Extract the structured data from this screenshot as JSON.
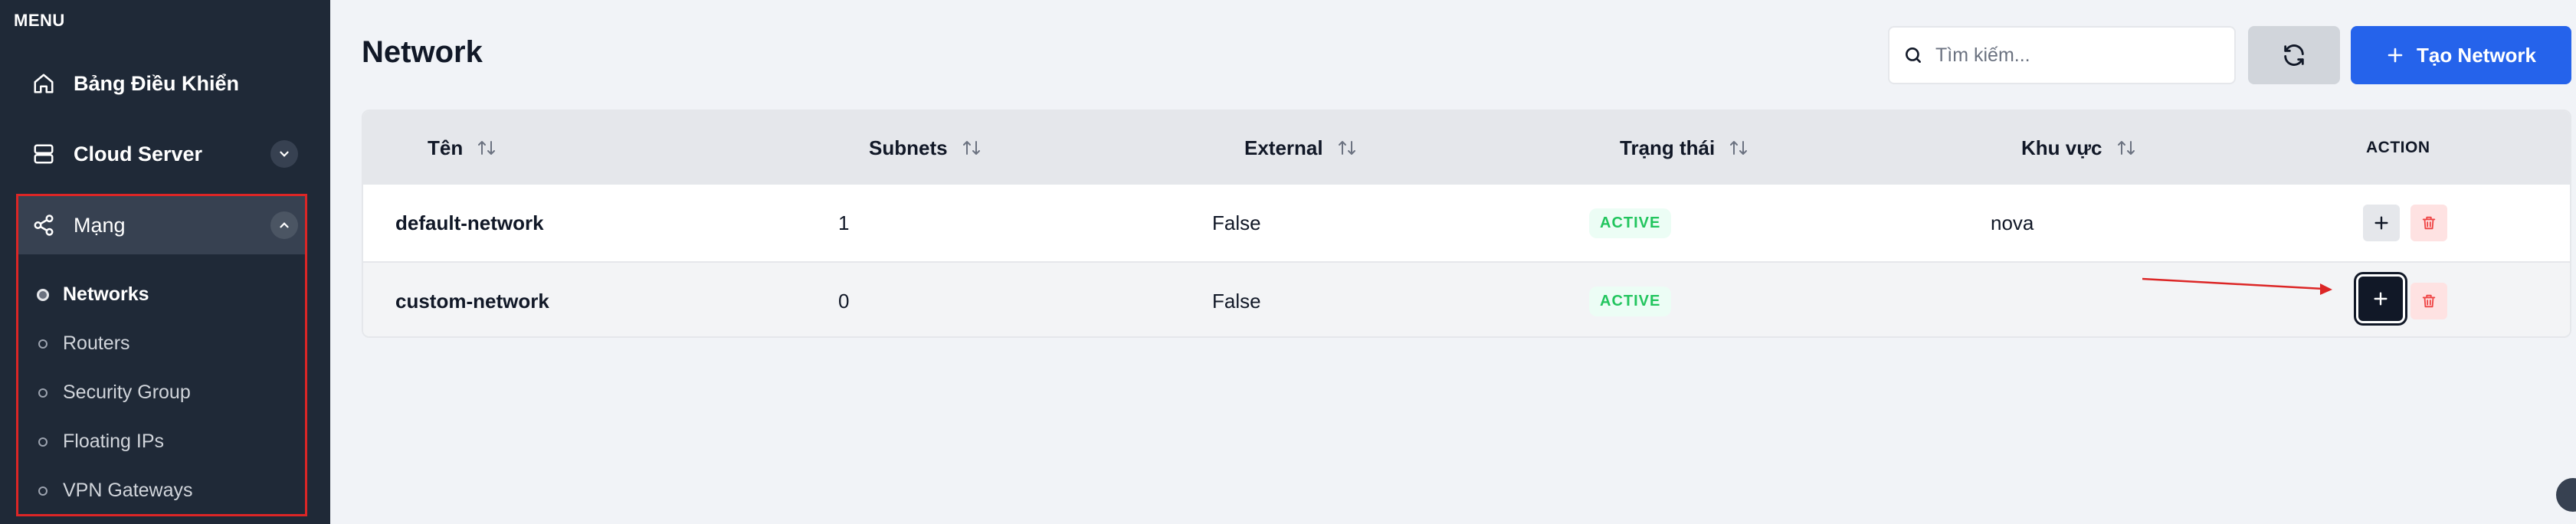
{
  "sidebar": {
    "menu_label": "MENU",
    "items": [
      {
        "label": "Bảng Điều Khiển",
        "icon": "home-icon"
      },
      {
        "label": "Cloud Server",
        "icon": "server-icon"
      },
      {
        "label": "Mạng",
        "icon": "share-icon"
      }
    ],
    "sub_items": [
      {
        "label": "Networks",
        "active": true
      },
      {
        "label": "Routers"
      },
      {
        "label": "Security Group"
      },
      {
        "label": "Floating IPs"
      },
      {
        "label": "VPN Gateways"
      }
    ]
  },
  "header": {
    "title": "Network",
    "search_placeholder": "Tìm kiếm...",
    "create_label": "Tạo Network"
  },
  "table": {
    "columns": [
      "Tên",
      "Subnets",
      "External",
      "Trạng thái",
      "Khu vực",
      "ACTION"
    ],
    "rows": [
      {
        "name": "default-network",
        "subnets": "1",
        "external": "False",
        "status": "ACTIVE",
        "region": "nova"
      },
      {
        "name": "custom-network",
        "subnets": "0",
        "external": "False",
        "status": "ACTIVE",
        "region": ""
      }
    ]
  },
  "colors": {
    "sidebar_bg": "#1f2937",
    "primary": "#2563eb",
    "active_status": "#22c55e",
    "highlight": "#dc2626"
  }
}
